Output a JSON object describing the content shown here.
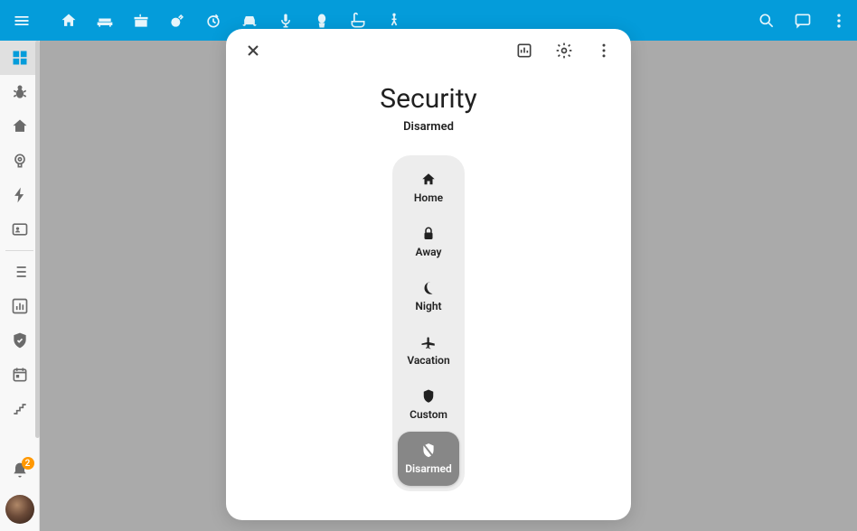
{
  "modal": {
    "title": "Security",
    "subtitle": "Disarmed",
    "options": [
      {
        "label": "Home"
      },
      {
        "label": "Away"
      },
      {
        "label": "Night"
      },
      {
        "label": "Vacation"
      },
      {
        "label": "Custom"
      },
      {
        "label": "Disarmed"
      }
    ]
  },
  "notifications": {
    "count": "2"
  }
}
